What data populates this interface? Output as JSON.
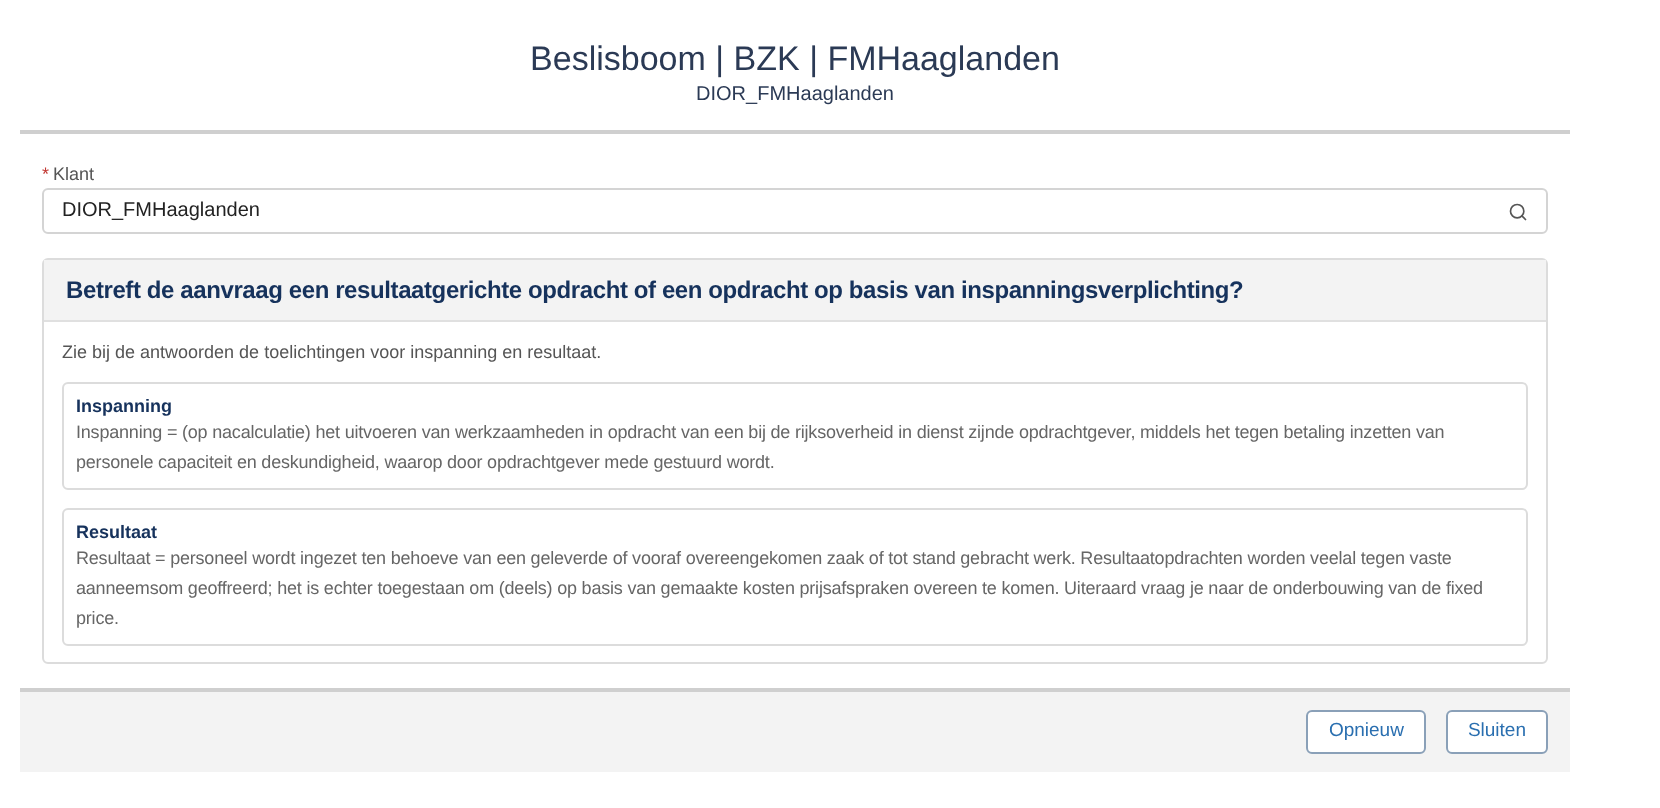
{
  "header": {
    "title": "Beslisboom | BZK | FMHaaglanden",
    "subtitle": "DIOR_FMHaaglanden"
  },
  "field": {
    "label": "Klant",
    "required_marker": "*",
    "value": "DIOR_FMHaaglanden"
  },
  "question": {
    "title": "Betreft de aanvraag een resultaatgerichte opdracht of een opdracht op basis van inspanningsverplichting?",
    "intro": "Zie bij de antwoorden de toelichtingen voor inspanning en resultaat.",
    "answers": [
      {
        "title": "Inspanning",
        "text": "Inspanning = (op nacalculatie) het uitvoeren van werkzaamheden in opdracht van een bij de rijksoverheid in dienst zijnde opdrachtgever, middels het tegen betaling inzetten van personele capaciteit en deskundigheid, waarop door opdrachtgever mede gestuurd wordt."
      },
      {
        "title": "Resultaat",
        "text": "Resultaat = personeel wordt ingezet ten behoeve van een geleverde of vooraf overeengekomen zaak of tot stand gebracht werk. Resultaatopdrachten worden veelal tegen vaste aanneemsom geoffreerd; het is echter toegestaan om (deels) op basis van gemaakte kosten prijsafspraken overeen te komen. Uiteraard vraag je naar de onderbouwing van de fixed price."
      }
    ]
  },
  "buttons": [
    "Opnieuw",
    "Sluiten"
  ]
}
